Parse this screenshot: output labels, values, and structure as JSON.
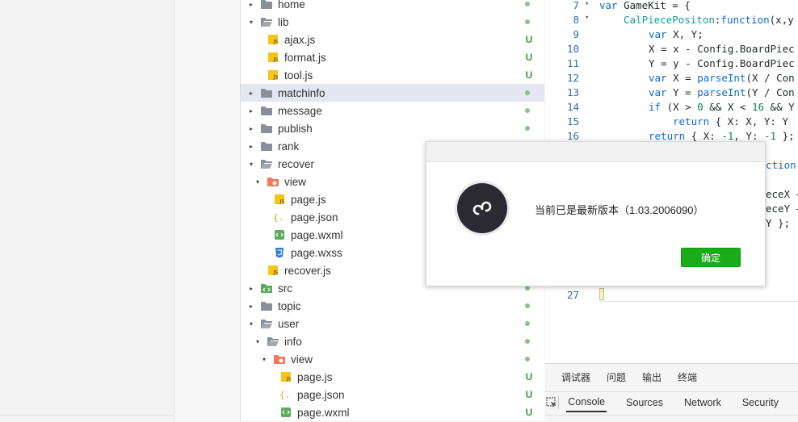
{
  "colors": {
    "accent": "#1aad19",
    "selected_row": "#e4e6f1",
    "modified_dot": "#8cc08c",
    "untracked": "#3a9a3a"
  },
  "file_tree": {
    "rows": [
      {
        "label": "home",
        "arrow": "▸",
        "icon": "folder-icon",
        "status": ""
      },
      {
        "label": "lib",
        "arrow": "▾",
        "icon": "folder-open-icon",
        "status": ""
      },
      {
        "label": "ajax.js",
        "arrow": "",
        "icon": "js-file-icon",
        "status": "U"
      },
      {
        "label": "format.js",
        "arrow": "",
        "icon": "js-file-icon",
        "status": "U"
      },
      {
        "label": "tool.js",
        "arrow": "",
        "icon": "js-file-icon",
        "status": "U"
      },
      {
        "label": "matchinfo",
        "arrow": "▸",
        "icon": "folder-icon",
        "status": ""
      },
      {
        "label": "message",
        "arrow": "▸",
        "icon": "folder-icon",
        "status": ""
      },
      {
        "label": "publish",
        "arrow": "▸",
        "icon": "folder-icon",
        "status": ""
      },
      {
        "label": "rank",
        "arrow": "▸",
        "icon": "folder-icon",
        "status": ""
      },
      {
        "label": "recover",
        "arrow": "▾",
        "icon": "folder-open-icon",
        "status": ""
      },
      {
        "label": "view",
        "arrow": "▾",
        "icon": "view-folder-icon",
        "status": ""
      },
      {
        "label": "page.js",
        "arrow": "",
        "icon": "js-file-icon",
        "status": ""
      },
      {
        "label": "page.json",
        "arrow": "",
        "icon": "json-file-icon",
        "status": ""
      },
      {
        "label": "page.wxml",
        "arrow": "",
        "icon": "wxml-file-icon",
        "status": ""
      },
      {
        "label": "page.wxss",
        "arrow": "",
        "icon": "wxss-file-icon",
        "status": ""
      },
      {
        "label": "recover.js",
        "arrow": "",
        "icon": "js-file-icon",
        "status": ""
      },
      {
        "label": "src",
        "arrow": "▸",
        "icon": "src-folder-icon",
        "status": ""
      },
      {
        "label": "topic",
        "arrow": "▸",
        "icon": "folder-icon",
        "status": ""
      },
      {
        "label": "user",
        "arrow": "▾",
        "icon": "folder-open-icon",
        "status": ""
      },
      {
        "label": "info",
        "arrow": "▾",
        "icon": "folder-open-icon",
        "status": ""
      },
      {
        "label": "view",
        "arrow": "▾",
        "icon": "view-folder-icon",
        "status": ""
      },
      {
        "label": "page.js",
        "arrow": "",
        "icon": "js-file-icon",
        "status": "U"
      },
      {
        "label": "page.json",
        "arrow": "",
        "icon": "json-file-icon",
        "status": "U"
      },
      {
        "label": "page.wxml",
        "arrow": "",
        "icon": "wxml-file-icon",
        "status": "U"
      }
    ]
  },
  "editor": {
    "line_numbers": [
      "7",
      "8",
      "9",
      "10",
      "11",
      "12",
      "13",
      "14",
      "15",
      "16",
      "27"
    ],
    "lines": {
      "l7a": "var",
      "l7b": " GameKit = {",
      "l8a": "CalPiecePositon",
      "l8b": ":",
      "l8c": "function",
      "l8d": "(x,y",
      "l9a": "var",
      "l9b": " X, Y;",
      "l10": "X = x - Config.BoardPiec",
      "l11": "Y = y - Config.BoardPiec",
      "l12a": "var",
      "l12b": " X = ",
      "l12c": "parseInt",
      "l12d": "(X / Con",
      "l13a": "var",
      "l13b": " Y = ",
      "l13c": "parseInt",
      "l13d": "(Y / Con",
      "l14a": "if",
      "l14b": " (X > ",
      "l14c": "0",
      "l14d": " && X < ",
      "l14e": "16",
      "l14f": " && Y",
      "l15a": "return",
      "l15b": " { X: X, Y: Y",
      "l16a": "return",
      "l16b": " { X: ",
      "l16c": "-1",
      "l16d": ", Y: ",
      "l16e": "-1",
      "l16f": " };",
      "frag1": "ction(X",
      "frag2": "eceX +",
      "frag3": "eceY +",
      "frag4": "Y };"
    }
  },
  "devtools": {
    "tabs": [
      "调试器",
      "问题",
      "输出",
      "终端"
    ],
    "subtabs": [
      "Console",
      "Sources",
      "Network",
      "Security"
    ],
    "active_subtab": "Console"
  },
  "dialog": {
    "message": "当前已是最新版本（1.03.2006090）",
    "ok_label": "确定"
  }
}
